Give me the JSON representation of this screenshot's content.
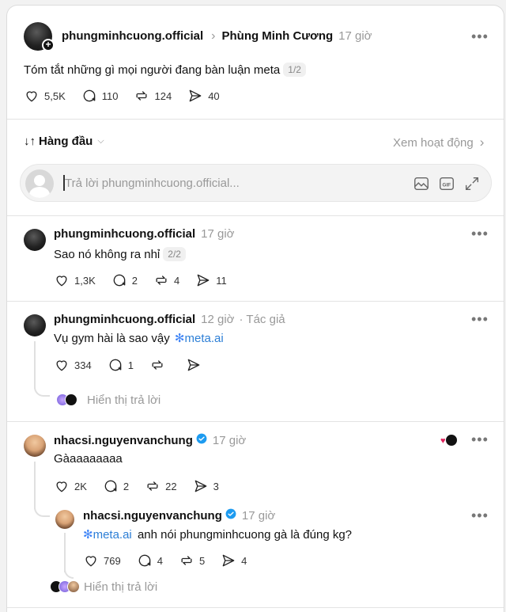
{
  "post": {
    "username": "phungminhcuong.official",
    "breadcrumb_sep": "›",
    "display_name": "Phùng Minh Cương",
    "time": "17 giờ",
    "text": "Tóm tắt những gì mọi người đang bàn luận meta",
    "pager": "1/2",
    "likes": "5,5K",
    "comments": "110",
    "reposts": "124",
    "shares": "40"
  },
  "sort": {
    "label": "Hàng đầu",
    "activity_link": "Xem hoạt động",
    "activity_chevron": "›"
  },
  "reply_input": {
    "placeholder": "Trả lời phungminhcuong.official..."
  },
  "replies": [
    {
      "username": "phungminhcuong.official",
      "time": "17 giờ",
      "text": "Sao nó không ra nhỉ",
      "pager": "2/2",
      "likes": "1,3K",
      "comments": "2",
      "reposts": "4",
      "shares": "11"
    },
    {
      "username": "phungminhcuong.official",
      "time": "12 giờ",
      "author_tag": "· Tác giả",
      "text_prefix": "Vụ gym hài là sao vậy",
      "mention": "meta.ai",
      "likes": "334",
      "comments": "1",
      "show_replies": "Hiển thị trả lời"
    },
    {
      "username": "nhacsi.nguyenvanchung",
      "time": "17 giờ",
      "text": "Gàaaaaaaaa",
      "likes": "2K",
      "comments": "2",
      "reposts": "22",
      "shares": "3",
      "nested": {
        "username": "nhacsi.nguyenvanchung",
        "time": "17 giờ",
        "mention": "meta.ai",
        "text_suffix": "anh nói phungminhcuong gà là đúng kg?",
        "likes": "769",
        "comments": "4",
        "reposts": "5",
        "shares": "4"
      },
      "show_replies": "Hiển thị trả lời"
    }
  ],
  "colors": {
    "link": "#2d7fd6",
    "verified": "#1d9bf0",
    "like_red": "#e0245e",
    "meta_ai": "#3b82f6"
  }
}
